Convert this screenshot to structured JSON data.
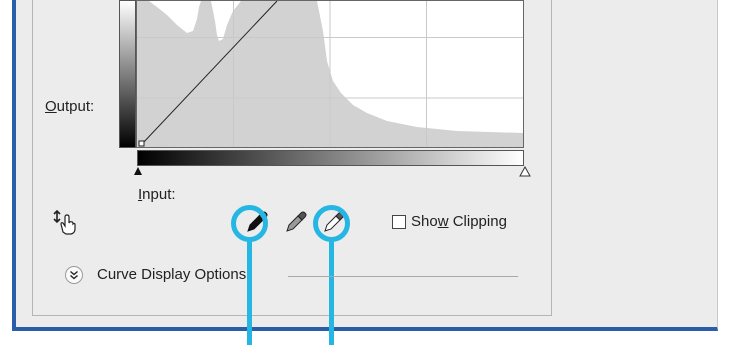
{
  "curves_panel": {
    "output_label": "Output:",
    "output_mnemonic": "O",
    "output_rest": "utput:",
    "input_label": "Input:",
    "input_mnemonic": "I",
    "input_rest": "nput:",
    "show_clipping_label": "Show Clipping",
    "show_clipping_pre": "Sho",
    "show_clipping_mnemonic": "w",
    "show_clipping_post": " Clipping",
    "show_clipping_checked": false,
    "curve_display_options_label": "Curve Display Options",
    "icons": {
      "on_image_adjust": "hand-target-icon",
      "black_point": "eyedropper-black-icon",
      "gray_point": "eyedropper-gray-icon",
      "white_point": "eyedropper-white-icon",
      "expand": "chevron-double-down-icon"
    }
  },
  "colors": {
    "callout": "#25b6e4",
    "frame_border": "#2a5ea8",
    "panel_bg": "#ececec",
    "histogram_fill": "#d2d2d2"
  }
}
